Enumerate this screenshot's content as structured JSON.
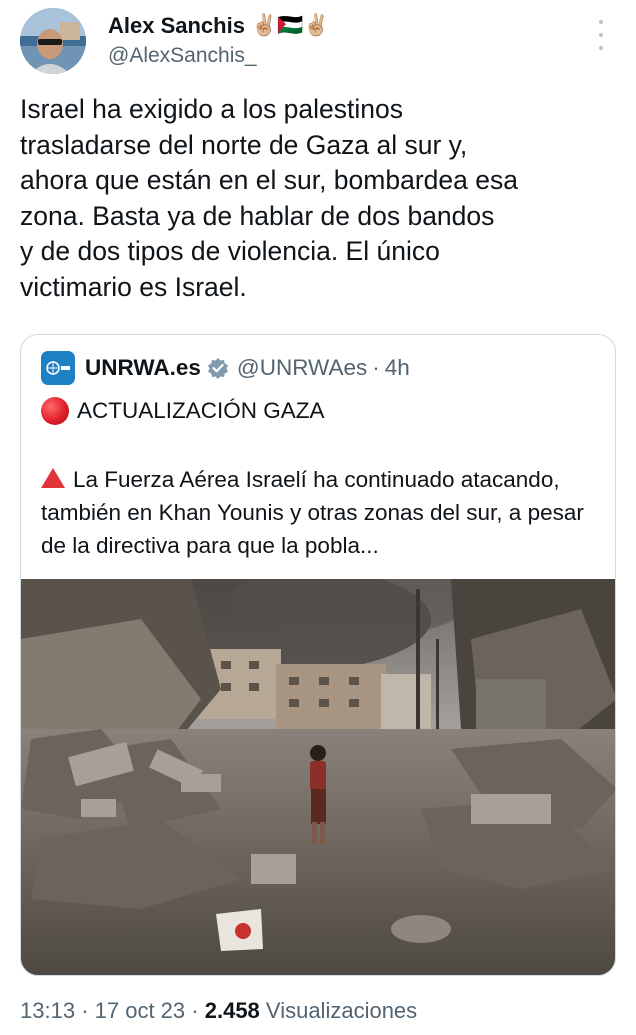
{
  "author": {
    "display_name": "Alex Sanchis",
    "name_emoji": "✌🏼🇵🇸✌🏼",
    "handle": "@AlexSanchis_"
  },
  "tweet": {
    "text": "Israel ha exigido a los palestinos\ntrasladarse del norte de Gaza al sur y,\nahora que están en el sur, bombardea esa\nzona. Basta ya de hablar de dos bandos\ny de dos tipos de violencia. El único\nvictimario es Israel."
  },
  "quoted": {
    "name": "UNRWA.es",
    "handle": "@UNRWAes",
    "separator": "·",
    "time": "4h",
    "headline": "ACTUALIZACIÓN GAZA",
    "body": "La Fuerza Aérea Israelí ha continuado atacando, también en Khan Younis y otras zonas del sur, a pesar de la directiva para que la pobla..."
  },
  "footer": {
    "time": "13:13",
    "sep1": "·",
    "date": "17 oct 23",
    "sep2": "·",
    "views_count": "2.458",
    "views_label": "Visualizaciones"
  },
  "icons": {
    "more": "more-options-icon",
    "verified": "verified-badge-icon",
    "headline_marker": "red-circle-icon",
    "body_marker": "red-triangle-icon"
  },
  "colors": {
    "text": "#0f1419",
    "secondary": "#536471",
    "border": "#cfd9de",
    "unrwa_blue": "#1d7fc4",
    "alert_red": "#e0202a"
  }
}
